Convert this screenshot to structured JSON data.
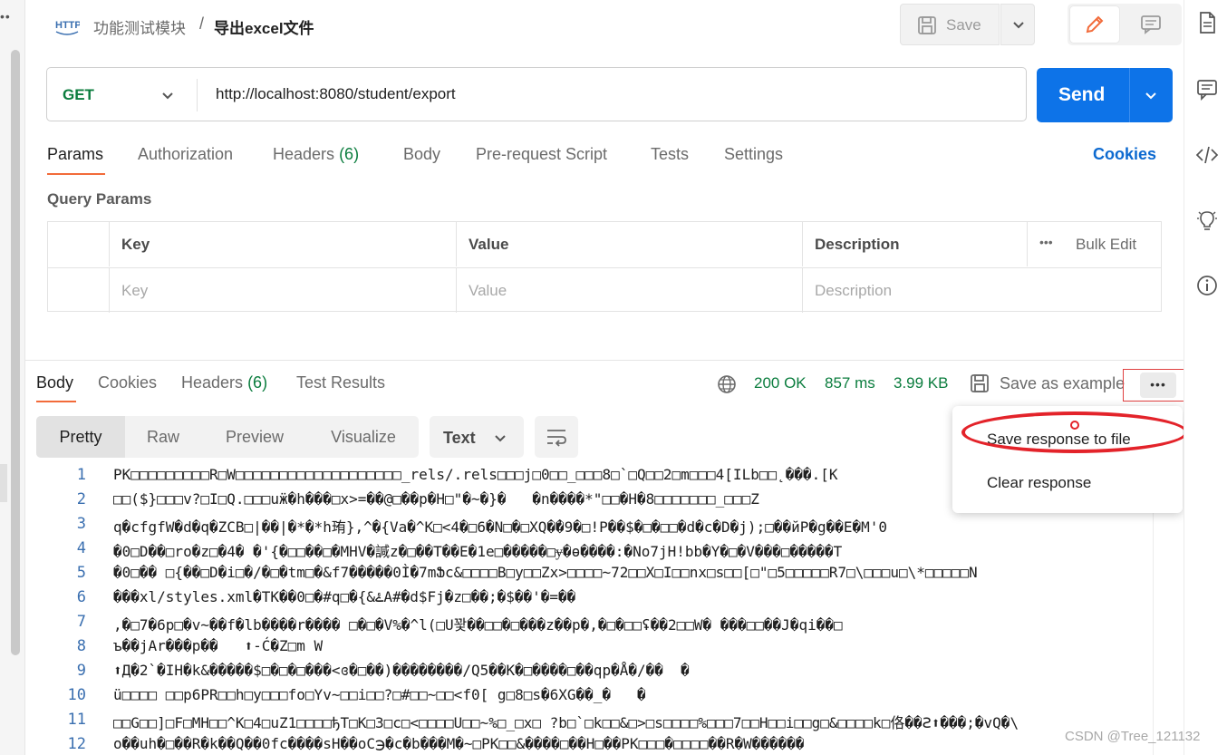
{
  "header": {
    "breadcrumb_parent": "功能测试模块",
    "breadcrumb_sep": "/",
    "breadcrumb_current": "导出excel文件",
    "save_label": "Save"
  },
  "request": {
    "method": "GET",
    "url": "http://localhost:8080/student/export",
    "send_label": "Send"
  },
  "request_tabs": {
    "params": "Params",
    "authorization": "Authorization",
    "headers": "Headers",
    "headers_count": "(6)",
    "body": "Body",
    "prerequest": "Pre-request Script",
    "tests": "Tests",
    "settings": "Settings",
    "cookies": "Cookies"
  },
  "query_params": {
    "title": "Query Params",
    "columns": [
      "Key",
      "Value",
      "Description"
    ],
    "bulk_edit": "Bulk Edit",
    "placeholders": [
      "Key",
      "Value",
      "Description"
    ]
  },
  "response_tabs": {
    "body": "Body",
    "cookies": "Cookies",
    "headers": "Headers",
    "headers_count": "(6)",
    "test_results": "Test Results"
  },
  "response_status": {
    "status": "200 OK",
    "time": "857 ms",
    "size": "3.99 KB",
    "save_as_example": "Save as example"
  },
  "view_modes": [
    "Pretty",
    "Raw",
    "Preview",
    "Visualize"
  ],
  "format_select": "Text",
  "menu": {
    "save_response": "Save response to file",
    "clear_response": "Clear response"
  },
  "code_lines": [
    {
      "n": "1",
      "t": "PK□□□□□□□□□R□W□□□□□□□□□□□□□□□□□□□_rels/.rels□□□j□0□□_□□□8□`□Q□□2□m□□□4[ILb□□˛���.[K"
    },
    {
      "n": "2",
      "t": "□□($}□□□v?□I□Q.□□□uӝ�h���□x>=��@□��p�H□\"�~�}�   �n����*\"□□�H�8□□□□□□□_□□□Z"
    },
    {
      "n": "3",
      "t": "q�cfgfW�d�q�ZCB□|��|�*�*h珛},^�{Va�^K□<4�□6�N□�□XQ�ܳ�9�□!P��$�□�□□�d�c�D�j);□��йP�g��E�M'0"
    },
    {
      "n": "4",
      "t": "�0□D��□ro�z□�4� �'{�□□��□�MHV�諴z�□��T��E�1e□�����□ɏ�ɵ����:�No7jH!bb�Y�□�V���□�����T"
    },
    {
      "n": "5",
      "t": "�0□�� □{��□D�i□�/�□�tm□�&f7�����0Ì�7mՖc&□□□□B□y□□Zx>□□□□~72□□X□I□□nx□s□□[□\"□5□□□□□R7□\\□□□u□\\*□□□□□N"
    },
    {
      "n": "6",
      "t": "���xl/styles.xml�TK��0□�#q□�{&ۓA#�d$Fj�z□��;�$��'�=��"
    },
    {
      "n": "7",
      "t": ",�□7�6p□�v~��f�lb����r���� □�□�V%�^l(□U꽟��□□�□���z��p�,�□�□□ʢ��2□□W� ���□□��J�qi��□"
    },
    {
      "n": "8",
      "t": "ъ��jAr���p��   ⬆-Ć�Z□m W"
    },
    {
      "n": "9",
      "t": "⬆Д�2`�IH�k&�����$□�□�□���<ɞ�□��)��������/Q5��K�□����□��qp�Å�/��  �"
    },
    {
      "n": "10",
      "t": "ü□□□□ □□p6PR□□h□y□□□fo□Yv~□□i□□?□#□□~□□<f0[ g□8□s�6XG��_�   �"
    },
    {
      "n": "11",
      "t": "□□G□□]□F□MH□□^K□4□uZ1□□□□ђT□K□3□c□<□□□□U□□~%□_□x□ ?b□`□k□□&□>□s□□□□%□□□7□□H□□i□□g□&□□□□k□佫��Ꙅ⬆���;�vQ�\\"
    },
    {
      "n": "12",
      "t": "o��uh�□��R�k��Q��0fc����sH��oC℈�c�b���M�~□PK□□&����□��H□��PK□□□�□□□□��R�W������"
    }
  ],
  "watermark": "CSDN @Tree_121132"
}
